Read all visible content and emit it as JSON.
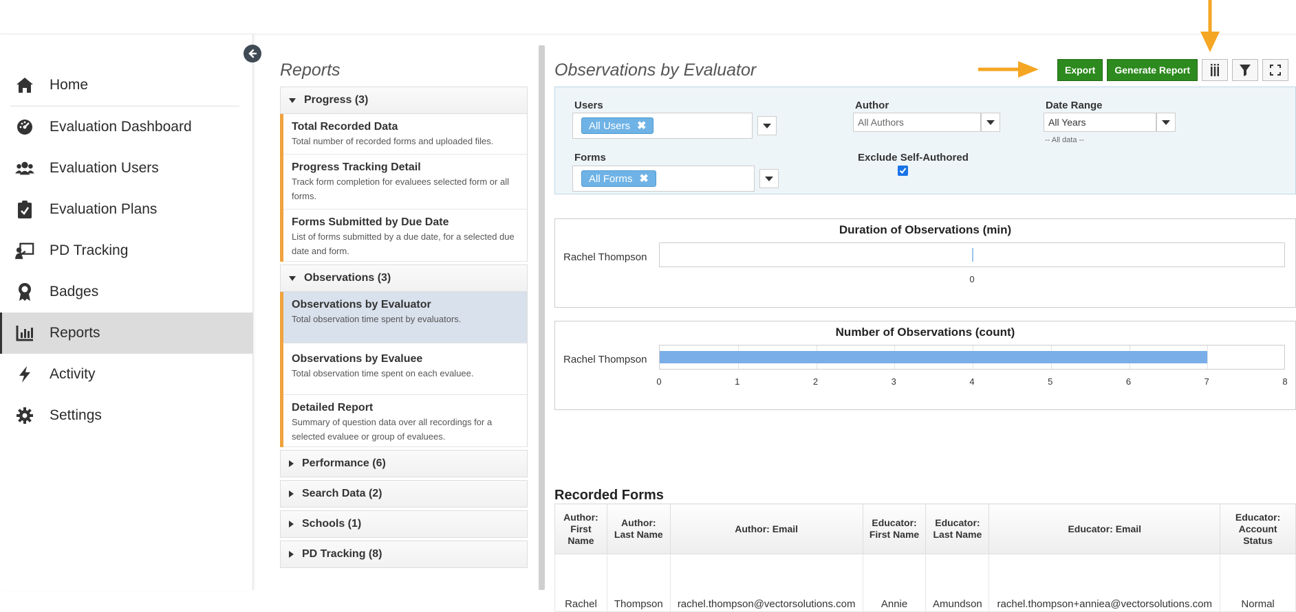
{
  "nav": {
    "items": [
      {
        "label": "Home",
        "icon": "home-icon"
      },
      {
        "label": "Evaluation Dashboard",
        "icon": "dashboard-icon"
      },
      {
        "label": "Evaluation Users",
        "icon": "users-icon"
      },
      {
        "label": "Evaluation Plans",
        "icon": "clipboard-check-icon"
      },
      {
        "label": "PD Tracking",
        "icon": "presentation-icon"
      },
      {
        "label": "Badges",
        "icon": "badge-icon"
      },
      {
        "label": "Reports",
        "icon": "bar-chart-icon",
        "active": true
      },
      {
        "label": "Activity",
        "icon": "bolt-icon"
      },
      {
        "label": "Settings",
        "icon": "gear-icon"
      }
    ]
  },
  "reports": {
    "title": "Reports",
    "groups": [
      {
        "label": "Progress (3)",
        "expanded": true,
        "items": [
          {
            "title": "Total Recorded Data",
            "desc": "Total number of recorded forms and uploaded files."
          },
          {
            "title": "Progress Tracking Detail",
            "desc": "Track form completion for evaluees selected form or all forms."
          },
          {
            "title": "Forms Submitted by Due Date",
            "desc": "List of forms submitted by a due date, for a selected due date and form."
          }
        ]
      },
      {
        "label": "Observations (3)",
        "expanded": true,
        "items": [
          {
            "title": "Observations by Evaluator",
            "desc": "Total observation time spent by evaluators.",
            "selected": true
          },
          {
            "title": "Observations by Evaluee",
            "desc": "Total observation time spent on each evaluee."
          },
          {
            "title": "Detailed Report",
            "desc": "Summary of question data over all recordings for a selected evaluee or group of evaluees."
          }
        ]
      },
      {
        "label": "Performance (6)",
        "expanded": false
      },
      {
        "label": "Search Data (2)",
        "expanded": false
      },
      {
        "label": "Schools (1)",
        "expanded": false
      },
      {
        "label": "PD Tracking (8)",
        "expanded": false
      }
    ]
  },
  "main": {
    "title": "Observations by Evaluator",
    "toolbar": {
      "export_label": "Export",
      "generate_label": "Generate Report"
    },
    "filters": {
      "users_label": "Users",
      "users_tag": "All Users",
      "forms_label": "Forms",
      "forms_tag": "All Forms",
      "author_label": "Author",
      "author_placeholder": "All Authors",
      "exclude_label": "Exclude Self-Authored",
      "date_label": "Date Range",
      "date_value": "All Years",
      "date_note": "-- All data --"
    }
  },
  "chart_data": [
    {
      "type": "bar",
      "title": "Duration of Observations (min)",
      "categories": [
        "Rachel Thompson"
      ],
      "values": [
        0
      ],
      "xticks": [
        "0"
      ]
    },
    {
      "type": "bar",
      "title": "Number of Observations (count)",
      "categories": [
        "Rachel Thompson"
      ],
      "values": [
        7
      ],
      "xlim": [
        0,
        8
      ],
      "xticks": [
        "0",
        "1",
        "2",
        "3",
        "4",
        "5",
        "6",
        "7",
        "8"
      ],
      "bar_color": "#7aaee8"
    }
  ],
  "table": {
    "title": "Recorded Forms",
    "headers": [
      "Author: First Name",
      "Author: Last Name",
      "Author: Email",
      "Educator: First Name",
      "Educator: Last Name",
      "Educator: Email",
      "Educator: Account Status"
    ],
    "rows": [
      [
        "Rachel",
        "Thompson",
        "rachel.thompson@vectorsolutions.com",
        "Annie",
        "Amundson",
        "rachel.thompson+anniea@vectorsolutions.com",
        "Normal"
      ]
    ]
  },
  "colors": {
    "accent_orange": "#f0a240",
    "button_green": "#2d8a1e",
    "arrow": "#f5a623"
  }
}
